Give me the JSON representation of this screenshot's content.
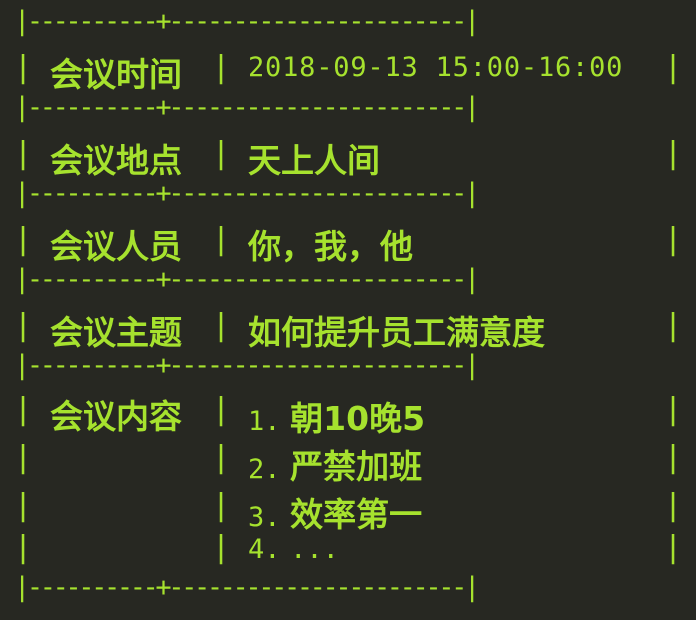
{
  "colors": {
    "background": "#272822",
    "text": "#a6e22e"
  },
  "table": {
    "border_line": "|----------+-----------------------|",
    "rows": [
      {
        "label": "会议时间",
        "value": "2018-09-13 15:00-16:00"
      },
      {
        "label": "会议地点",
        "value": "天上人间"
      },
      {
        "label": "会议人员",
        "value": "你，我，他"
      },
      {
        "label": "会议主题",
        "value": "如何提升员工满意度"
      }
    ],
    "content": {
      "label": "会议内容",
      "items": [
        {
          "num": "1.",
          "text": "朝10晚5"
        },
        {
          "num": "2.",
          "text": "严禁加班"
        },
        {
          "num": "3.",
          "text": "效率第一"
        },
        {
          "num": "4.",
          "text": "..."
        }
      ]
    }
  }
}
